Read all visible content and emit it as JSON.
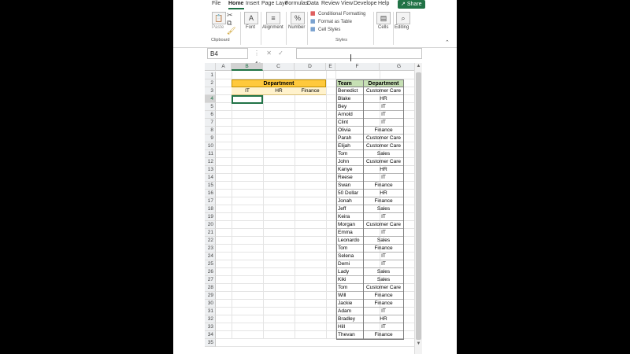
{
  "ribbon": {
    "tabs": [
      "File",
      "Home",
      "Insert",
      "Page Layo",
      "Formulas",
      "Data",
      "Review",
      "View",
      "Develope",
      "Help"
    ],
    "active_tab": "Home",
    "share_label": "Share",
    "paste_label": "Paste",
    "clipboard_label": "Clipboard",
    "font_label": "Font",
    "alignment_label": "Alignment",
    "number_label": "Number",
    "conditional_formatting": "Conditional Formatting",
    "format_as_table": "Format as Table",
    "cell_styles": "Cell Styles",
    "styles_label": "Styles",
    "cells_label": "Cells",
    "editing_label": "Editing"
  },
  "formula_bar": {
    "name_box": "B4",
    "fx": "fx",
    "value": ""
  },
  "sheet": {
    "columns": [
      "A",
      "B",
      "C",
      "D",
      "E",
      "F",
      "G"
    ],
    "rows": [
      "1",
      "2",
      "3",
      "4",
      "5",
      "6",
      "7",
      "8",
      "9",
      "10",
      "11",
      "12",
      "13",
      "14",
      "15",
      "16",
      "17",
      "18",
      "19",
      "20",
      "21",
      "22",
      "23",
      "24",
      "25",
      "26",
      "27",
      "28",
      "29",
      "30",
      "31",
      "32",
      "33",
      "34",
      "35"
    ],
    "selected_cell": "B4",
    "department_header": "Department",
    "department_options": [
      "IT",
      "HR",
      "Finance"
    ],
    "table_headers": [
      "Team",
      "Department"
    ],
    "table_rows": [
      [
        "Benedict",
        "Customer Care"
      ],
      [
        "Blake",
        "HR"
      ],
      [
        "Bey",
        "IT"
      ],
      [
        "Arnold",
        "IT"
      ],
      [
        "Clint",
        "IT"
      ],
      [
        "Olivia",
        "Finance"
      ],
      [
        "Parah",
        "Customer Care"
      ],
      [
        "Elijah",
        "Customer Care"
      ],
      [
        "Tom",
        "Sales"
      ],
      [
        "John",
        "Customer Care"
      ],
      [
        "Kanye",
        "HR"
      ],
      [
        "Reese",
        "IT"
      ],
      [
        "Swan",
        "Finance"
      ],
      [
        "50 Dollar",
        "HR"
      ],
      [
        "Jonah",
        "Finance"
      ],
      [
        "Jeff",
        "Sales"
      ],
      [
        "Keira",
        "IT"
      ],
      [
        "Morgan",
        "Customer Care"
      ],
      [
        "Emma",
        "IT"
      ],
      [
        "Leonardo",
        "Sales"
      ],
      [
        "Tom",
        "Finance"
      ],
      [
        "Selena",
        "IT"
      ],
      [
        "Demi",
        "IT"
      ],
      [
        "Lady",
        "Sales"
      ],
      [
        "Kiki",
        "Sales"
      ],
      [
        "Tom",
        "Customer Care"
      ],
      [
        "Will",
        "Finance"
      ],
      [
        "Jackie",
        "Finance"
      ],
      [
        "Adam",
        "IT"
      ],
      [
        "Bradley",
        "HR"
      ],
      [
        "Hill",
        "IT"
      ],
      [
        "Thevan",
        "Finance"
      ]
    ]
  },
  "colors": {
    "excel_green": "#217346",
    "department_header_fill": "#ffc93c",
    "department_option_fill": "#fff2cc",
    "table_header_fill": "#c6e0b4",
    "heart": "#e0302f"
  },
  "overlay_icon": "heart-icon"
}
